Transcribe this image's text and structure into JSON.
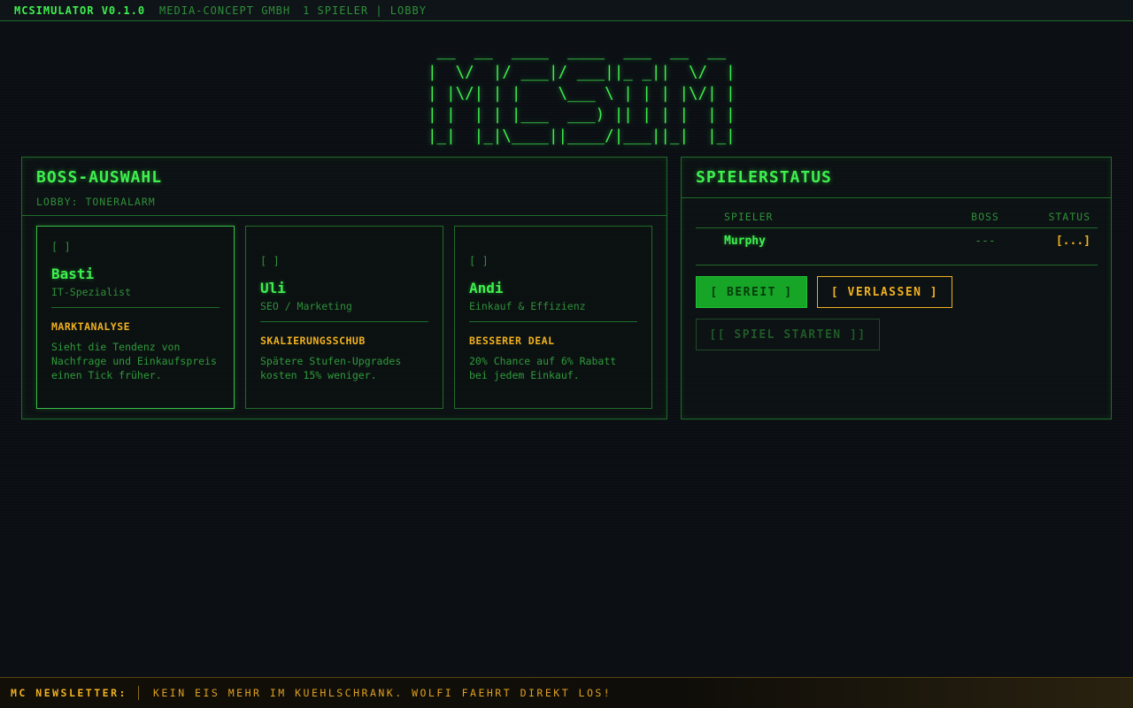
{
  "topbar": {
    "app_title": "MCSIMULATOR V0.1.0",
    "company": "MEDIA-CONCEPT GMBH",
    "lobby_info": "1 SPIELER | LOBBY"
  },
  "logo": {
    "ascii": " __  __  ____  ____  ___  __  __ \n|  \\/  |/ ___|/ ___||_ _||  \\/  |\n| |\\/| | |    \\___ \\ | | | |\\/| |\n| |  | | |___  ___) || | | |  | |\n|_|  |_|\\____||____/|___||_|  |_|"
  },
  "boss_panel": {
    "title": "BOSS-AUSWAHL",
    "lobby_label": "LOBBY: TONERALARM",
    "bosses": [
      {
        "check": "[ ]",
        "name": "Basti",
        "role": "IT-Spezialist",
        "skill": "MARKTANALYSE",
        "description": "Sieht die Tendenz von Nachfrage und Einkaufspreis einen Tick früher."
      },
      {
        "check": "[ ]",
        "name": "Uli",
        "role": "SEO / Marketing",
        "skill": "SKALIERUNGSSCHUB",
        "description": "Spätere Stufen-Upgrades kosten 15% weniger."
      },
      {
        "check": "[ ]",
        "name": "Andi",
        "role": "Einkauf & Effizienz",
        "skill": "BESSERER DEAL",
        "description": "20% Chance auf 6% Rabatt bei jedem Einkauf."
      }
    ]
  },
  "status_panel": {
    "title": "SPIELERSTATUS",
    "columns": {
      "player": "SPIELER",
      "boss": "BOSS",
      "status": "STATUS"
    },
    "rows": [
      {
        "player": "Murphy",
        "boss": "---",
        "status": "[...]"
      }
    ],
    "buttons": {
      "ready": "[ BEREIT ]",
      "leave": "[ VERLASSEN ]",
      "start": "[[ SPIEL STARTEN ]]"
    }
  },
  "ticker": {
    "label": "MC NEWSLETTER:",
    "text": "KEIN EIS MEHR IM KUEHLSCHRANK. WOLFI FAEHRT DIREKT LOS!"
  },
  "colors": {
    "accent": "#3ef04e",
    "warning": "#f0b020",
    "background": "#0b0f14"
  }
}
